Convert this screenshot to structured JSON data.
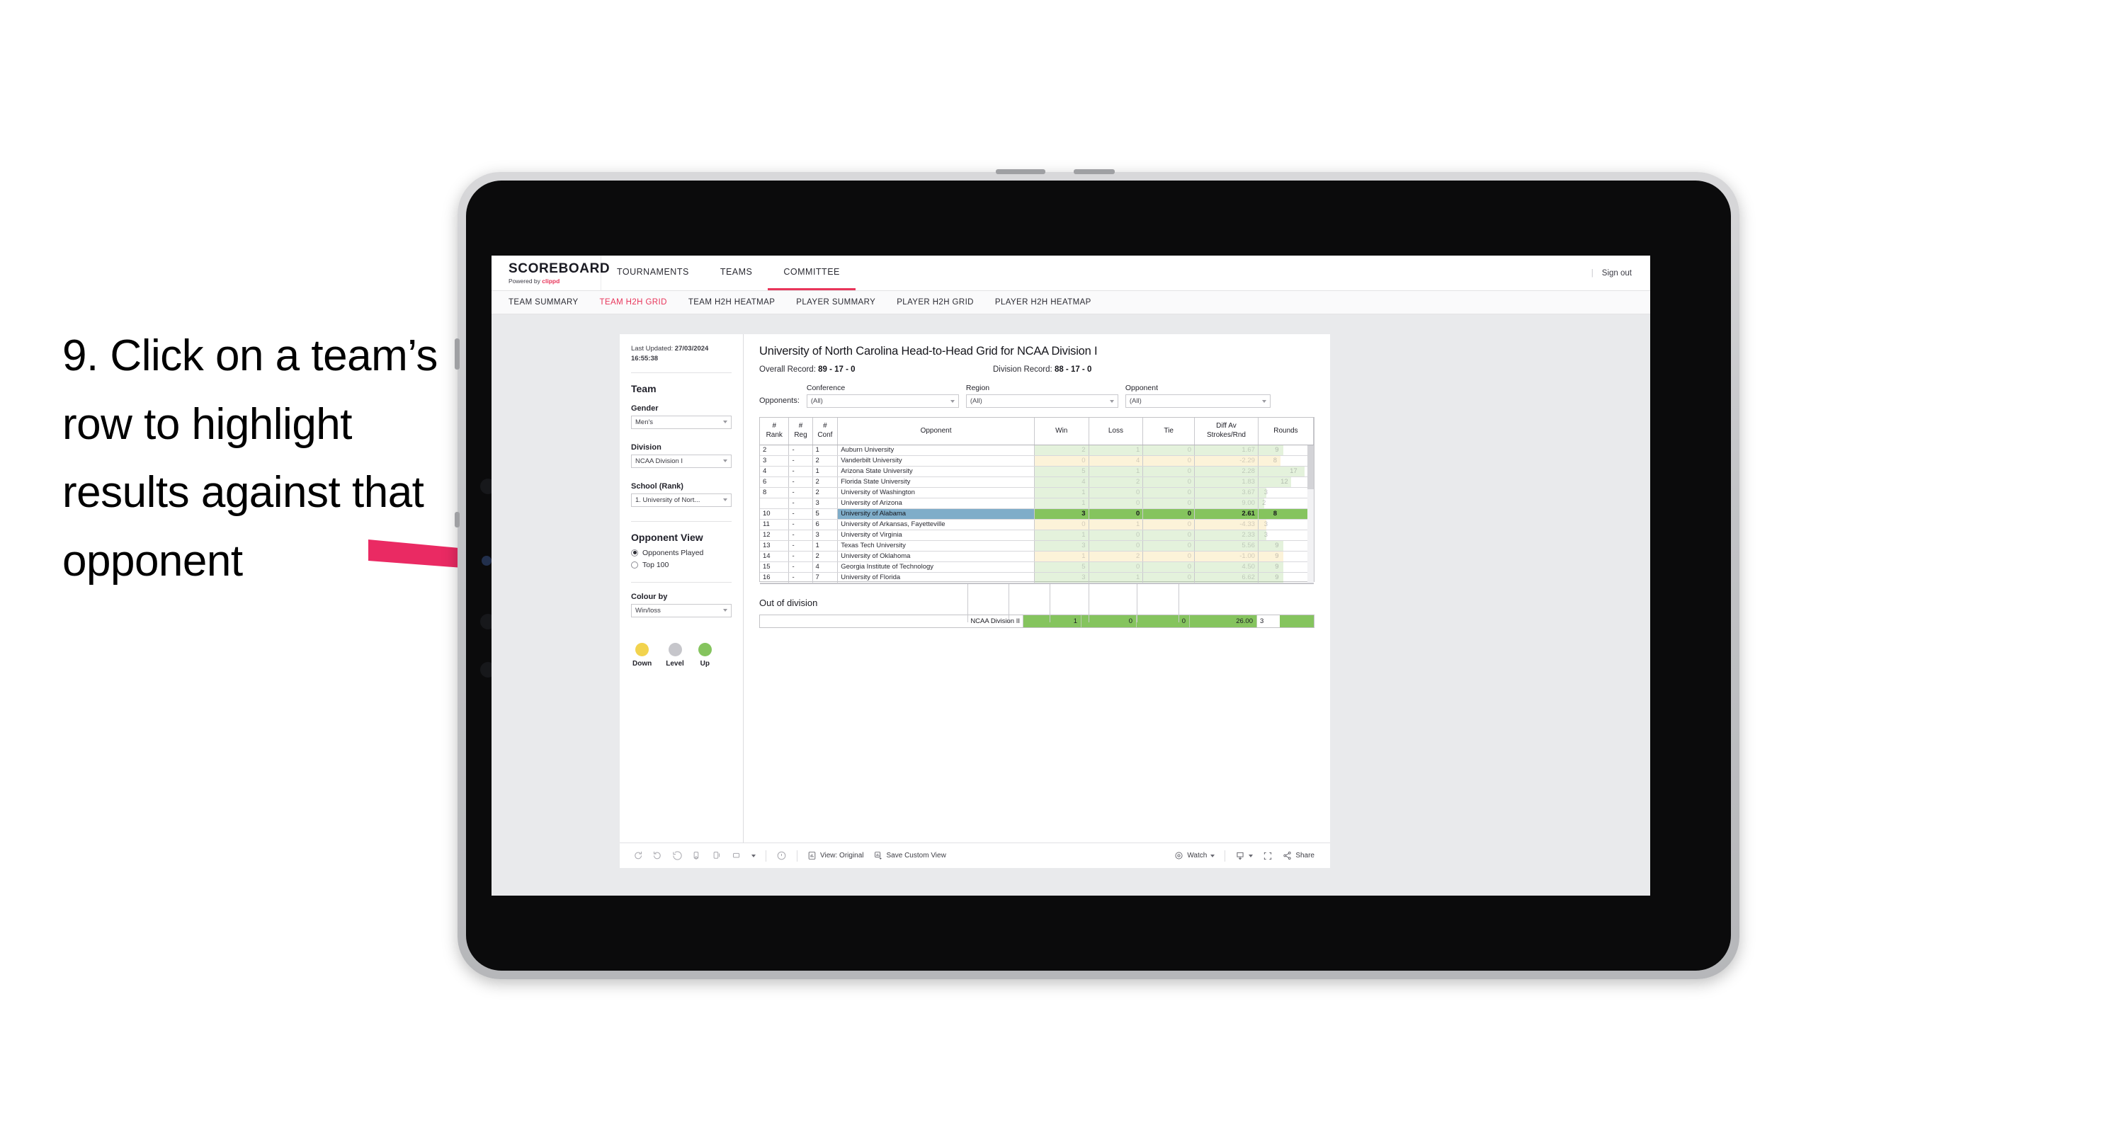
{
  "annotation": {
    "text": "9. Click on a team’s row to highlight results against that opponent"
  },
  "app": {
    "brand_title": "SCOREBOARD",
    "brand_sub_prefix": "Powered by ",
    "brand_sub_accent": "clippd",
    "top_nav": [
      {
        "label": "TOURNAMENTS",
        "active": false
      },
      {
        "label": "TEAMS",
        "active": false
      },
      {
        "label": "COMMITTEE",
        "active": true
      }
    ],
    "header_divider": "|",
    "sign_out": "Sign out",
    "sub_nav": [
      {
        "label": "TEAM SUMMARY",
        "active": false
      },
      {
        "label": "TEAM H2H GRID",
        "active": true
      },
      {
        "label": "TEAM H2H HEATMAP",
        "active": false
      },
      {
        "label": "PLAYER SUMMARY",
        "active": false
      },
      {
        "label": "PLAYER H2H GRID",
        "active": false
      },
      {
        "label": "PLAYER H2H HEATMAP",
        "active": false
      }
    ]
  },
  "sidebar": {
    "last_updated_label": "Last Updated:",
    "last_updated_value": "27/03/2024 16:55:38",
    "team_heading": "Team",
    "gender_label": "Gender",
    "gender_value": "Men's",
    "division_label": "Division",
    "division_value": "NCAA Division I",
    "school_label": "School (Rank)",
    "school_value": "1. University of Nort...",
    "opponent_view_heading": "Opponent View",
    "opponent_view_options": [
      {
        "label": "Opponents Played",
        "selected": true
      },
      {
        "label": "Top 100",
        "selected": false
      }
    ],
    "colour_by_label": "Colour by",
    "colour_by_value": "Win/loss",
    "legend": [
      {
        "label": "Down",
        "color": "#f2d34e"
      },
      {
        "label": "Level",
        "color": "#c6c6cb"
      },
      {
        "label": "Up",
        "color": "#85c45e"
      }
    ]
  },
  "main": {
    "title": "University of North Carolina Head-to-Head Grid for NCAA Division I",
    "overall_record_label": "Overall Record:",
    "overall_record_value": "89 - 17 - 0",
    "division_record_label": "Division Record:",
    "division_record_value": "88 - 17 - 0",
    "opponents_label": "Opponents:",
    "filters": [
      {
        "name": "Conference",
        "value": "(All)"
      },
      {
        "name": "Region",
        "value": "(All)"
      },
      {
        "name": "Opponent",
        "value": "(All)"
      }
    ],
    "out_of_division_title": "Out of division",
    "out_of_division_row": {
      "name": "NCAA Division II",
      "win": "1",
      "loss": "0",
      "tie": "0",
      "diff": "26.00",
      "rounds": "3"
    }
  },
  "chart_data": {
    "type": "table",
    "title": "University of North Carolina Head-to-Head Grid for NCAA Division I",
    "columns": [
      "# Rank",
      "# Reg",
      "# Conf",
      "Opponent",
      "Win",
      "Loss",
      "Tie",
      "Diff Av Strokes/Rnd",
      "Rounds"
    ],
    "column_headers_multiline": [
      [
        "#",
        "Rank"
      ],
      [
        "#",
        "Reg"
      ],
      [
        "#",
        "Conf"
      ],
      [
        "Opponent"
      ],
      [
        "Win"
      ],
      [
        "Loss"
      ],
      [
        "Tie"
      ],
      [
        "Diff Av",
        "Strokes/Rnd"
      ],
      [
        "Rounds"
      ]
    ],
    "selected_row_index": 6,
    "rows": [
      {
        "rank": "2",
        "reg": "-",
        "conf": "1",
        "opponent": "Auburn University",
        "win": "2",
        "loss": "1",
        "tie": "0",
        "diff": "1.67",
        "rounds": "9",
        "state": "up",
        "rounds_bar": 0.45,
        "selected": false
      },
      {
        "rank": "3",
        "reg": "-",
        "conf": "2",
        "opponent": "Vanderbilt University",
        "win": "0",
        "loss": "4",
        "tie": "0",
        "diff": "-2.29",
        "rounds": "8",
        "state": "down",
        "rounds_bar": 0.4,
        "selected": false
      },
      {
        "rank": "4",
        "reg": "-",
        "conf": "1",
        "opponent": "Arizona State University",
        "win": "5",
        "loss": "1",
        "tie": "0",
        "diff": "2.28",
        "rounds": "17",
        "state": "up",
        "rounds_bar": 0.85,
        "selected": false
      },
      {
        "rank": "6",
        "reg": "-",
        "conf": "2",
        "opponent": "Florida State University",
        "win": "4",
        "loss": "2",
        "tie": "0",
        "diff": "1.83",
        "rounds": "12",
        "state": "up",
        "rounds_bar": 0.6,
        "selected": false
      },
      {
        "rank": "8",
        "reg": "-",
        "conf": "2",
        "opponent": "University of Washington",
        "win": "1",
        "loss": "0",
        "tie": "0",
        "diff": "3.67",
        "rounds": "3",
        "state": "up",
        "rounds_bar": 0.15,
        "selected": false
      },
      {
        "rank": "",
        "reg": "-",
        "conf": "3",
        "opponent": "University of Arizona",
        "win": "1",
        "loss": "0",
        "tie": "0",
        "diff": "9.00",
        "rounds": "2",
        "state": "up",
        "rounds_bar": 0.1,
        "selected": false
      },
      {
        "rank": "10",
        "reg": "-",
        "conf": "5",
        "opponent": "University of Alabama",
        "win": "3",
        "loss": "0",
        "tie": "0",
        "diff": "2.61",
        "rounds": "8",
        "state": "up",
        "rounds_bar": 0.4,
        "selected": true
      },
      {
        "rank": "11",
        "reg": "-",
        "conf": "6",
        "opponent": "University of Arkansas, Fayetteville",
        "win": "0",
        "loss": "1",
        "tie": "0",
        "diff": "-4.33",
        "rounds": "3",
        "state": "down",
        "rounds_bar": 0.15,
        "selected": false
      },
      {
        "rank": "12",
        "reg": "-",
        "conf": "3",
        "opponent": "University of Virginia",
        "win": "1",
        "loss": "0",
        "tie": "0",
        "diff": "2.33",
        "rounds": "3",
        "state": "up",
        "rounds_bar": 0.15,
        "selected": false
      },
      {
        "rank": "13",
        "reg": "-",
        "conf": "1",
        "opponent": "Texas Tech University",
        "win": "3",
        "loss": "0",
        "tie": "0",
        "diff": "5.56",
        "rounds": "9",
        "state": "up",
        "rounds_bar": 0.45,
        "selected": false
      },
      {
        "rank": "14",
        "reg": "-",
        "conf": "2",
        "opponent": "University of Oklahoma",
        "win": "1",
        "loss": "2",
        "tie": "0",
        "diff": "-1.00",
        "rounds": "9",
        "state": "down",
        "rounds_bar": 0.45,
        "selected": false
      },
      {
        "rank": "15",
        "reg": "-",
        "conf": "4",
        "opponent": "Georgia Institute of Technology",
        "win": "5",
        "loss": "0",
        "tie": "0",
        "diff": "4.50",
        "rounds": "9",
        "state": "up",
        "rounds_bar": 0.45,
        "selected": false
      },
      {
        "rank": "16",
        "reg": "-",
        "conf": "7",
        "opponent": "University of Florida",
        "win": "3",
        "loss": "1",
        "tie": "0",
        "diff": "6.62",
        "rounds": "9",
        "state": "up",
        "rounds_bar": 0.45,
        "selected": false
      }
    ]
  },
  "toolbar": {
    "view_label": "View: Original",
    "save_label": "Save Custom View",
    "watch_label": "Watch",
    "share_label": "Share"
  }
}
